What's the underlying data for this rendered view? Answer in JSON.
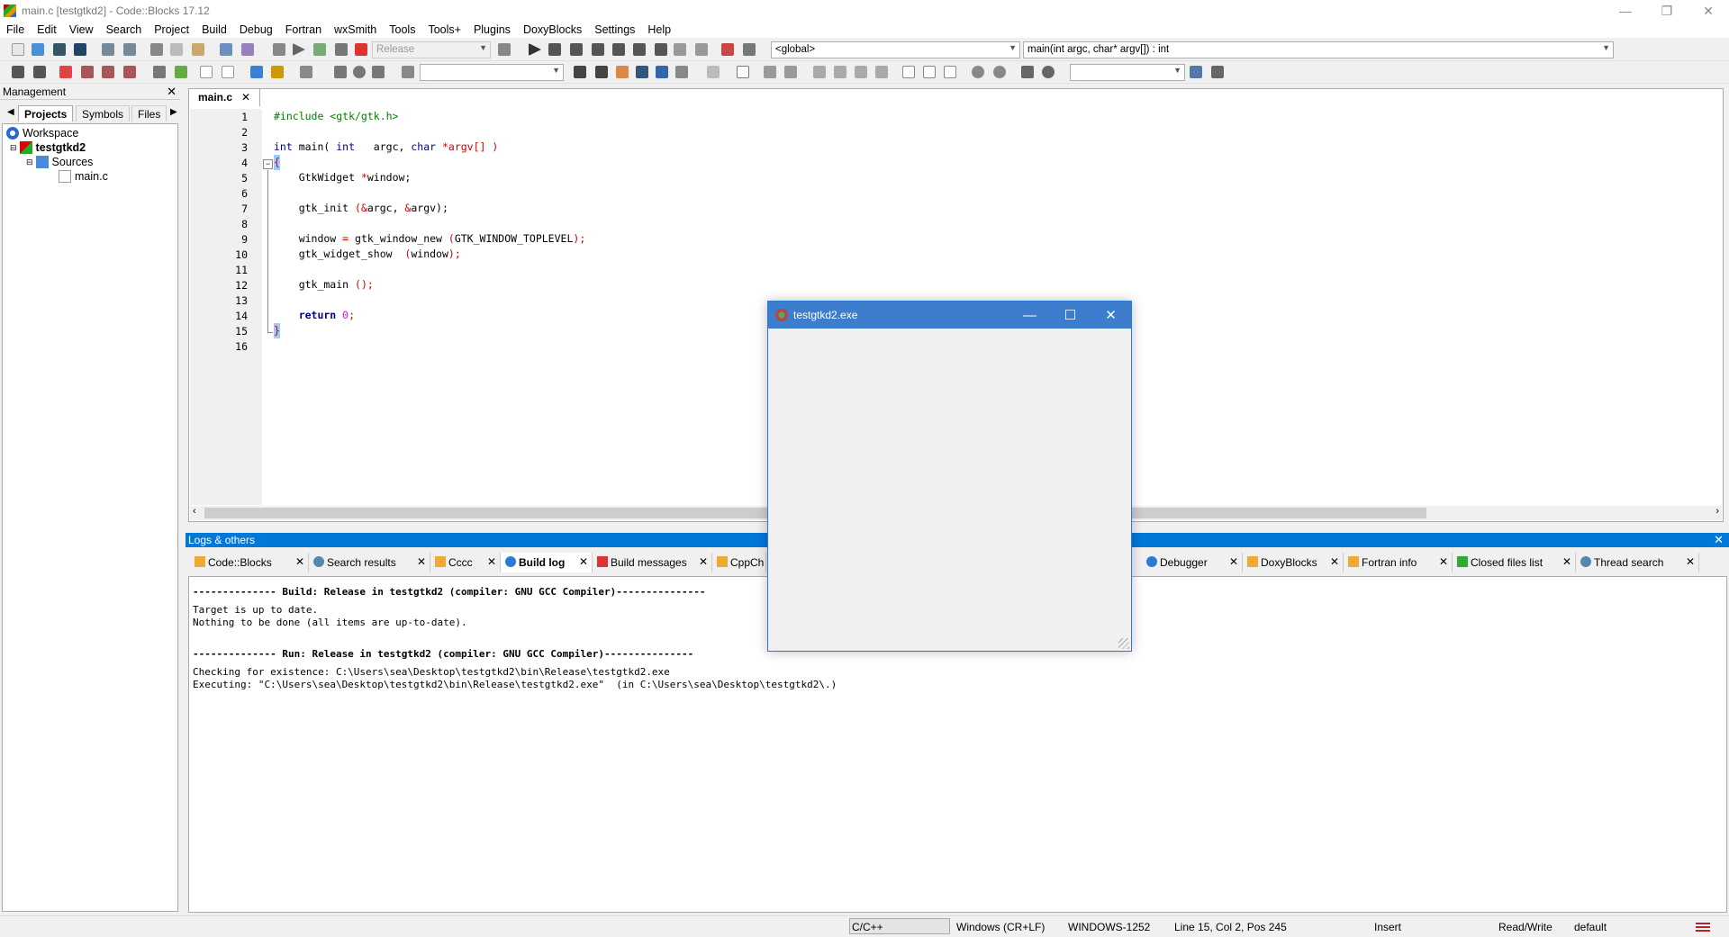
{
  "window": {
    "title": "main.c [testgtkd2] - Code::Blocks 17.12",
    "controls": [
      "—",
      "❐",
      "✕"
    ]
  },
  "menu": [
    "File",
    "Edit",
    "View",
    "Search",
    "Project",
    "Build",
    "Debug",
    "Fortran",
    "wxSmith",
    "Tools",
    "Tools+",
    "Plugins",
    "DoxyBlocks",
    "Settings",
    "Help"
  ],
  "toolbar": {
    "build_target": "Release",
    "scope": "<global>",
    "function": "main(int argc, char* argv[]) : int"
  },
  "management": {
    "title": "Management",
    "tabs": [
      "Projects",
      "Symbols",
      "Files"
    ],
    "tree": {
      "workspace": "Workspace",
      "project": "testgtkd2",
      "folder": "Sources",
      "file": "main.c"
    }
  },
  "editor": {
    "tab": "main.c"
  },
  "code": {
    "l1": "#include <gtk/gtk.h>",
    "l3a": "int",
    "l3b": " main( ",
    "l3c": "int",
    "l3d": "   argc, ",
    "l3e": "char",
    "l3f": " *argv[] )",
    "l4": "{",
    "l5a": "    GtkWidget ",
    "l5b": "*",
    "l5c": "window;",
    "l7a": "    gtk_init ",
    "l7b": "(&",
    "l7c": "argc, ",
    "l7d": "&",
    "l7e": "argv);",
    "l9a": "    window ",
    "l9b": "=",
    "l9c": " gtk_window_new ",
    "l9d": "(",
    "l9e": "GTK_WINDOW_TOPLEVEL",
    ")": ")",
    "l9f": ");",
    "l10a": "    gtk_widget_show  ",
    "l10b": "(",
    "l10c": "window",
    "l10d": ");",
    "l12a": "    gtk_main ",
    "l12b": "();",
    "l14a": "    return ",
    "l14b": "0",
    "l14c": ";",
    "l15": "}"
  },
  "line_numbers": [
    "1",
    "2",
    "3",
    "4",
    "5",
    "6",
    "7",
    "8",
    "9",
    "10",
    "11",
    "12",
    "13",
    "14",
    "15",
    "16"
  ],
  "logs": {
    "title": "Logs & others",
    "tabs": [
      "Code::Blocks",
      "Search results",
      "Cccc",
      "Build log",
      "Build messages",
      "CppCh",
      "Debugger",
      "DoxyBlocks",
      "Fortran info",
      "Closed files list",
      "Thread search"
    ],
    "lines": [
      "-------------- Build: Release in testgtkd2 (compiler: GNU GCC Compiler)---------------",
      "Target is up to date.",
      "Nothing to be done (all items are up-to-date).",
      "-------------- Run: Release in testgtkd2 (compiler: GNU GCC Compiler)---------------",
      "Checking for existence: C:\\Users\\sea\\Desktop\\testgtkd2\\bin\\Release\\testgtkd2.exe",
      "Executing: \"C:\\Users\\sea\\Desktop\\testgtkd2\\bin\\Release\\testgtkd2.exe\"  (in C:\\Users\\sea\\Desktop\\testgtkd2\\.)"
    ]
  },
  "status": {
    "lang": "C/C++",
    "eol": "Windows (CR+LF)",
    "enc": "WINDOWS-1252",
    "pos": "Line 15, Col 2, Pos 245",
    "mode": "Insert",
    "rw": "Read/Write",
    "perm": "default"
  },
  "dialog": {
    "title": "testgtkd2.exe",
    "controls": [
      "—",
      "☐",
      "✕"
    ]
  }
}
